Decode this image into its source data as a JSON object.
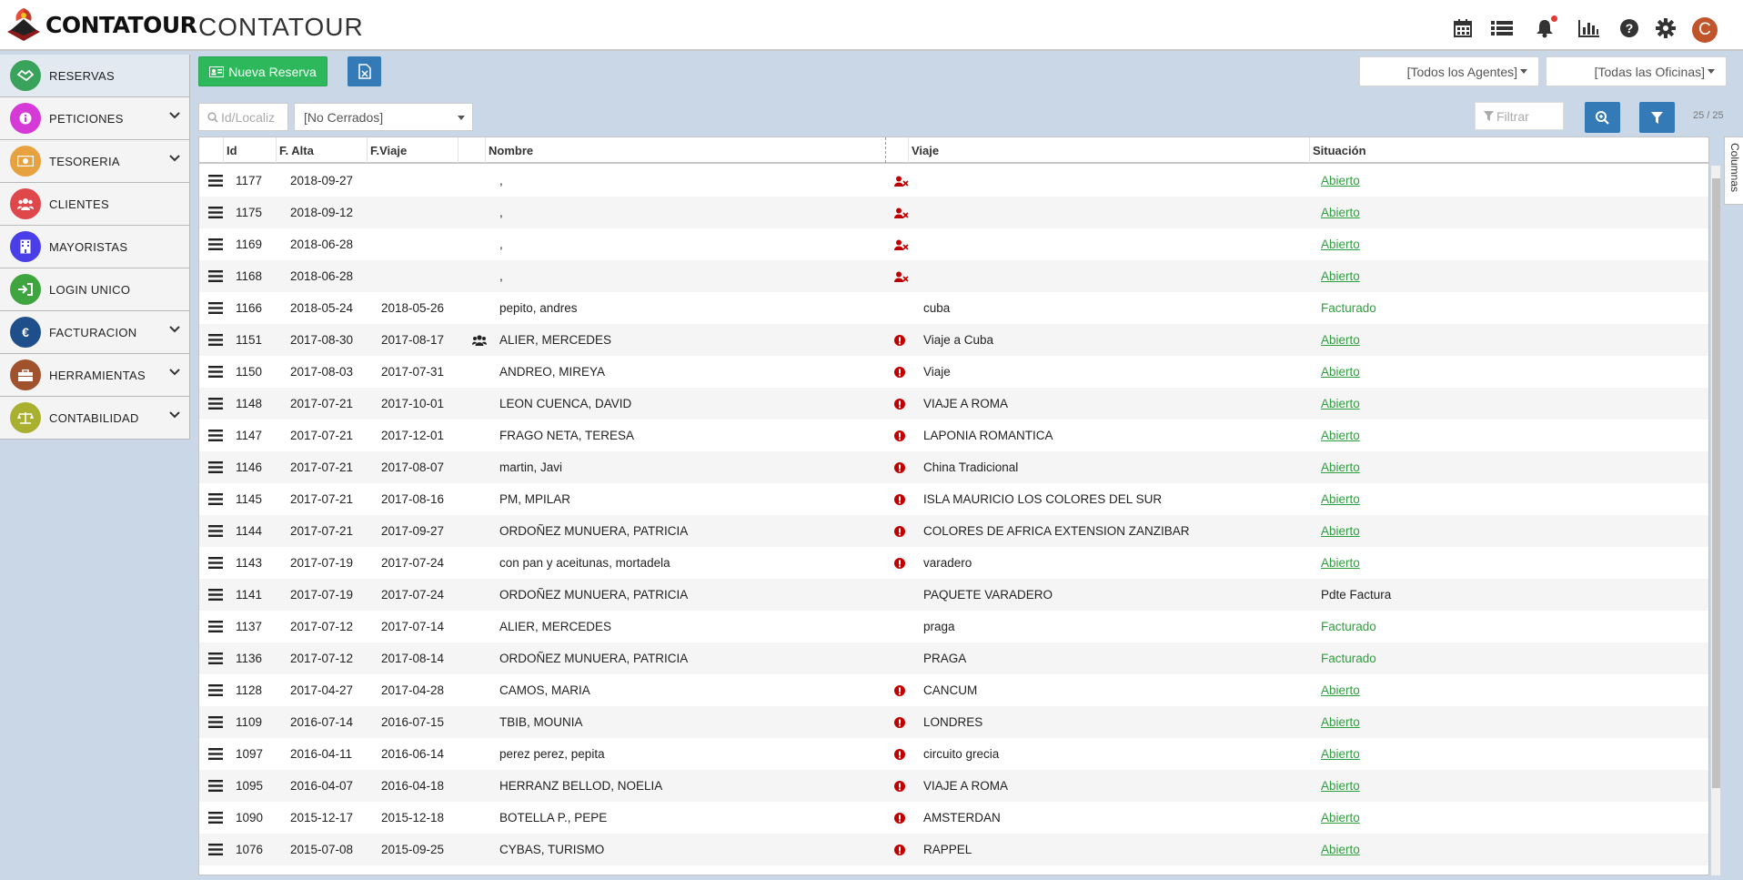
{
  "app": {
    "logo_text": "CONTATOUR",
    "title": "CONTATOUR",
    "avatar_initial": "C",
    "top_icons": [
      "calendar-icon",
      "list-icon",
      "bell-icon",
      "bar-chart-icon",
      "help-icon",
      "gear-icon"
    ]
  },
  "sidebar": {
    "items": [
      {
        "label": "RESERVAS",
        "color": "#3aa35b",
        "icon": "handshake-icon",
        "expandable": false
      },
      {
        "label": "PETICIONES",
        "color": "#d63ad6",
        "icon": "info-icon",
        "expandable": true
      },
      {
        "label": "TESORERIA",
        "color": "#e7a13e",
        "icon": "money-icon",
        "expandable": true
      },
      {
        "label": "CLIENTES",
        "color": "#e0474a",
        "icon": "users-icon",
        "expandable": false
      },
      {
        "label": "MAYORISTAS",
        "color": "#4a3ee8",
        "icon": "building-icon",
        "expandable": false
      },
      {
        "label": "LOGIN UNICO",
        "color": "#3fa53f",
        "icon": "login-icon",
        "expandable": false
      },
      {
        "label": "FACTURACION",
        "color": "#1f4f8a",
        "icon": "euro-icon",
        "expandable": true
      },
      {
        "label": "HERRAMIENTAS",
        "color": "#a0522d",
        "icon": "toolbox-icon",
        "expandable": true
      },
      {
        "label": "CONTABILIDAD",
        "color": "#a9b030",
        "icon": "scale-icon",
        "expandable": true
      }
    ]
  },
  "toolbar": {
    "new_label": "Nueva Reserva",
    "agents_label": "[Todos los Agentes]",
    "offices_label": "[Todas las Oficinas]",
    "search_placeholder": "Id/Localiz",
    "status_value": "[No Cerrados]",
    "filter_placeholder": "Filtrar",
    "count": "25 / 25"
  },
  "grid": {
    "columns": {
      "id": "Id",
      "alta": "F. Alta",
      "viaje": "F.Viaje",
      "nombre": "Nombre",
      "trip": "Viaje",
      "situacion": "Situación"
    },
    "columns_tab": "Columnas",
    "rows": [
      {
        "id": "1177",
        "alta": "2018-09-27",
        "viaje": "",
        "nombre": ",",
        "trip": "",
        "situacion": "Abierto",
        "sit_style": "link",
        "marker": "user-x",
        "group": false
      },
      {
        "id": "1175",
        "alta": "2018-09-12",
        "viaje": "",
        "nombre": ",",
        "trip": "",
        "situacion": "Abierto",
        "sit_style": "link",
        "marker": "user-x",
        "group": false
      },
      {
        "id": "1169",
        "alta": "2018-06-28",
        "viaje": "",
        "nombre": ",",
        "trip": "",
        "situacion": "Abierto",
        "sit_style": "link",
        "marker": "user-x",
        "group": false
      },
      {
        "id": "1168",
        "alta": "2018-06-28",
        "viaje": "",
        "nombre": ",",
        "trip": "",
        "situacion": "Abierto",
        "sit_style": "link",
        "marker": "user-x",
        "group": false
      },
      {
        "id": "1166",
        "alta": "2018-05-24",
        "viaje": "2018-05-26",
        "nombre": "pepito, andres",
        "trip": "cuba",
        "situacion": "Facturado",
        "sit_style": "plain",
        "marker": "",
        "group": false
      },
      {
        "id": "1151",
        "alta": "2017-08-30",
        "viaje": "2017-08-17",
        "nombre": "ALIER, MERCEDES",
        "trip": "Viaje a Cuba",
        "situacion": "Abierto",
        "sit_style": "link",
        "marker": "warn",
        "group": true
      },
      {
        "id": "1150",
        "alta": "2017-08-03",
        "viaje": "2017-07-31",
        "nombre": "ANDREO, MIREYA",
        "trip": "Viaje",
        "situacion": "Abierto",
        "sit_style": "link",
        "marker": "warn",
        "group": false
      },
      {
        "id": "1148",
        "alta": "2017-07-21",
        "viaje": "2017-10-01",
        "nombre": "LEON CUENCA, DAVID",
        "trip": "VIAJE A ROMA",
        "situacion": "Abierto",
        "sit_style": "link",
        "marker": "warn",
        "group": false
      },
      {
        "id": "1147",
        "alta": "2017-07-21",
        "viaje": "2017-12-01",
        "nombre": "FRAGO NETA, TERESA",
        "trip": "LAPONIA ROMANTICA",
        "situacion": "Abierto",
        "sit_style": "link",
        "marker": "warn",
        "group": false
      },
      {
        "id": "1146",
        "alta": "2017-07-21",
        "viaje": "2017-08-07",
        "nombre": "martin, Javi",
        "trip": "China Tradicional",
        "situacion": "Abierto",
        "sit_style": "link",
        "marker": "warn",
        "group": false
      },
      {
        "id": "1145",
        "alta": "2017-07-21",
        "viaje": "2017-08-16",
        "nombre": "PM, MPILAR",
        "trip": "ISLA MAURICIO LOS COLORES DEL SUR",
        "situacion": "Abierto",
        "sit_style": "link",
        "marker": "warn",
        "group": false
      },
      {
        "id": "1144",
        "alta": "2017-07-21",
        "viaje": "2017-09-27",
        "nombre": "ORDOÑEZ MUNUERA, PATRICIA",
        "trip": "COLORES DE AFRICA EXTENSION ZANZIBAR",
        "situacion": "Abierto",
        "sit_style": "link",
        "marker": "warn",
        "group": false
      },
      {
        "id": "1143",
        "alta": "2017-07-19",
        "viaje": "2017-07-24",
        "nombre": "con pan y aceitunas, mortadela",
        "trip": "varadero",
        "situacion": "Abierto",
        "sit_style": "link",
        "marker": "warn",
        "group": false
      },
      {
        "id": "1141",
        "alta": "2017-07-19",
        "viaje": "2017-07-24",
        "nombre": "ORDOÑEZ MUNUERA, PATRICIA",
        "trip": "PAQUETE VARADERO",
        "situacion": "Pdte Factura",
        "sit_style": "dark",
        "marker": "",
        "group": false
      },
      {
        "id": "1137",
        "alta": "2017-07-12",
        "viaje": "2017-07-14",
        "nombre": "ALIER, MERCEDES",
        "trip": "praga",
        "situacion": "Facturado",
        "sit_style": "plain",
        "marker": "",
        "group": false
      },
      {
        "id": "1136",
        "alta": "2017-07-12",
        "viaje": "2017-08-14",
        "nombre": "ORDOÑEZ MUNUERA, PATRICIA",
        "trip": "PRAGA",
        "situacion": "Facturado",
        "sit_style": "plain",
        "marker": "",
        "group": false
      },
      {
        "id": "1128",
        "alta": "2017-04-27",
        "viaje": "2017-04-28",
        "nombre": "CAMOS, MARIA",
        "trip": "CANCUM",
        "situacion": "Abierto",
        "sit_style": "link",
        "marker": "warn",
        "group": false
      },
      {
        "id": "1109",
        "alta": "2016-07-14",
        "viaje": "2016-07-15",
        "nombre": "TBIB, MOUNIA",
        "trip": "LONDRES",
        "situacion": "Abierto",
        "sit_style": "link",
        "marker": "warn",
        "group": false
      },
      {
        "id": "1097",
        "alta": "2016-04-11",
        "viaje": "2016-06-14",
        "nombre": "perez perez, pepita",
        "trip": "circuito grecia",
        "situacion": "Abierto",
        "sit_style": "link",
        "marker": "warn",
        "group": false
      },
      {
        "id": "1095",
        "alta": "2016-04-07",
        "viaje": "2016-04-18",
        "nombre": "HERRANZ BELLOD, NOELIA",
        "trip": "VIAJE A ROMA",
        "situacion": "Abierto",
        "sit_style": "link",
        "marker": "warn",
        "group": false
      },
      {
        "id": "1090",
        "alta": "2015-12-17",
        "viaje": "2015-12-18",
        "nombre": "BOTELLA P., PEPE",
        "trip": "AMSTERDAN",
        "situacion": "Abierto",
        "sit_style": "link",
        "marker": "warn",
        "group": false
      },
      {
        "id": "1076",
        "alta": "2015-07-08",
        "viaje": "2015-09-25",
        "nombre": "CYBAS, TURISMO",
        "trip": "RAPPEL",
        "situacion": "Abierto",
        "sit_style": "link",
        "marker": "warn",
        "group": false
      }
    ]
  },
  "colors": {
    "accent_green": "#2eb85c",
    "accent_blue": "#337ab7",
    "warn_red": "#c00000",
    "status_green": "#2e9e3e"
  }
}
